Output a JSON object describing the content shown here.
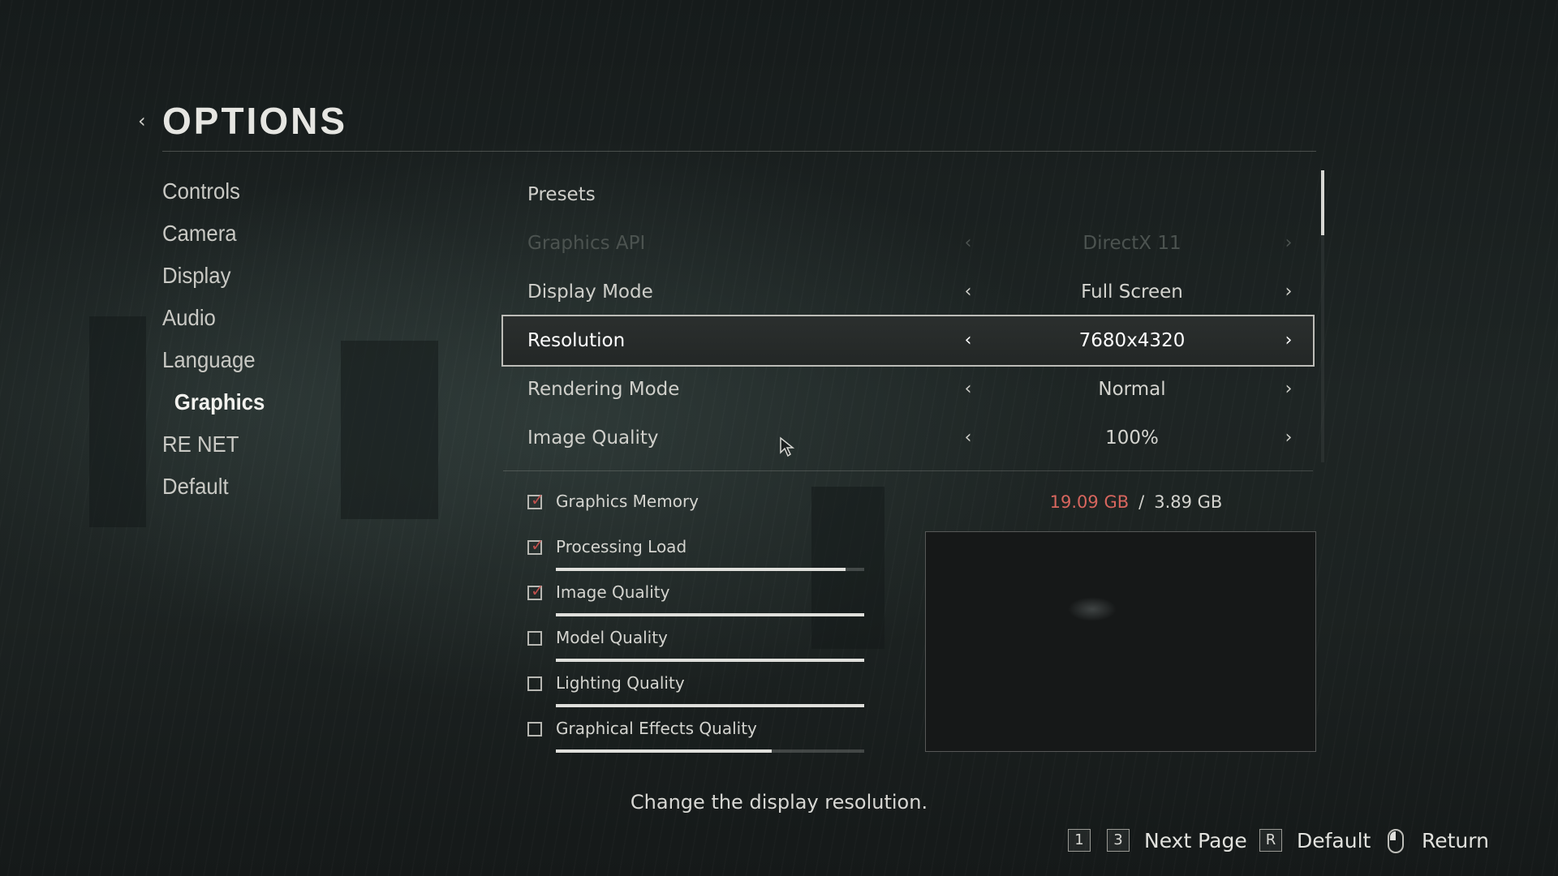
{
  "header": {
    "title": "OPTIONS"
  },
  "sidebar": {
    "items": [
      {
        "label": "Controls"
      },
      {
        "label": "Camera"
      },
      {
        "label": "Display"
      },
      {
        "label": "Audio"
      },
      {
        "label": "Language"
      },
      {
        "label": "Graphics",
        "active": true
      },
      {
        "label": "RE NET"
      },
      {
        "label": "Default"
      }
    ]
  },
  "settings": {
    "presets_label": "Presets",
    "rows": [
      {
        "label": "Graphics API",
        "value": "DirectX 11",
        "state": "disabled"
      },
      {
        "label": "Display Mode",
        "value": "Full Screen"
      },
      {
        "label": "Resolution",
        "value": "7680x4320",
        "state": "selected"
      },
      {
        "label": "Rendering Mode",
        "value": "Normal"
      },
      {
        "label": "Image Quality",
        "value": "100%"
      }
    ]
  },
  "memory": {
    "used": "19.09 GB",
    "separator": "/",
    "total": "3.89 GB"
  },
  "load_items": [
    {
      "label": "Graphics Memory",
      "checked": true,
      "bar": null
    },
    {
      "label": "Processing Load",
      "checked": true,
      "bar": 0.94
    },
    {
      "label": "Image Quality",
      "checked": true,
      "bar": 1.0
    },
    {
      "label": "Model Quality",
      "checked": false,
      "bar": 1.0
    },
    {
      "label": "Lighting Quality",
      "checked": false,
      "bar": 1.0
    },
    {
      "label": "Graphical Effects Quality",
      "checked": false,
      "bar": 0.7
    }
  ],
  "hint": "Change the display resolution.",
  "footer": {
    "key_1": "1",
    "key_3": "3",
    "next_page": "Next Page",
    "key_r": "R",
    "default": "Default",
    "return": "Return"
  },
  "colors": {
    "accent_red": "#d7665e",
    "text": "#d8d8d4"
  }
}
